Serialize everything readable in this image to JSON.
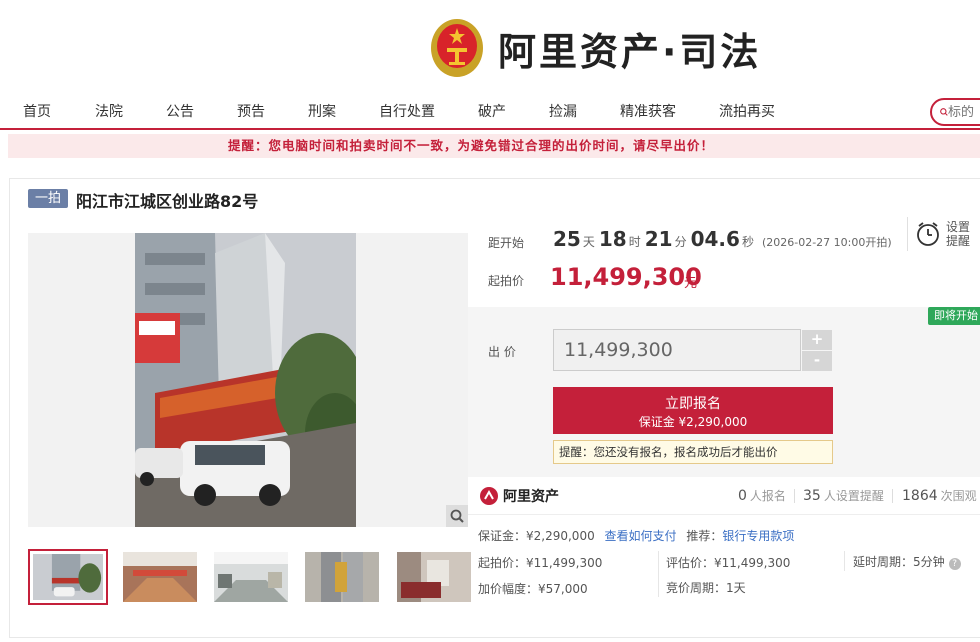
{
  "header": {
    "logo_text": "阿里资产·司法"
  },
  "nav": {
    "items": [
      "首页",
      "法院",
      "公告",
      "预告",
      "刑案",
      "自行处置",
      "破产",
      "捡漏",
      "精准获客",
      "流拍再买"
    ],
    "search_placeholder": "标的"
  },
  "notice": "提醒：您电脑时间和拍卖时间不一致，为避免错过合理的出价时间，请尽早出价！",
  "item": {
    "round_badge": "一拍",
    "title": "阳江市江城区创业路82号"
  },
  "countdown": {
    "label": "距开始",
    "days": "25",
    "days_unit": "天",
    "hours": "18",
    "hours_unit": "时",
    "minutes": "21",
    "minutes_unit": "分",
    "seconds": "04.6",
    "seconds_unit": "秒",
    "start_time": "(2026-02-27 10:00开拍)"
  },
  "starting_price": {
    "label": "起拍价",
    "value": "11,499,300",
    "unit": "元"
  },
  "reminder": {
    "line1": "设置",
    "line2": "提醒"
  },
  "bid": {
    "status_tag": "即将开始",
    "label": "出 价",
    "input_value": "11,499,300",
    "plus": "+",
    "minus": "-",
    "signup_label": "立即报名",
    "deposit_line": "保证金 ¥2,290,000",
    "hint": "提醒：您还没有报名，报名成功后才能出价"
  },
  "stats": {
    "brand": "阿里资产",
    "signups": "0",
    "signups_label": "人报名",
    "reminders": "35",
    "reminders_label": "人设置提醒",
    "views": "1864",
    "views_label": "次围观"
  },
  "details": {
    "deposit": "保证金：¥2,290,000",
    "how_to_pay": "查看如何支付",
    "recommend_label": "推荐：",
    "recommend_link": "银行专用款项",
    "start_price": "起拍价：¥11,499,300",
    "appraisal": "评估价：¥11,499,300",
    "delay": "延时周期：5分钟",
    "increment": "加价幅度：¥57,000",
    "cycle": "竞价周期：1天"
  },
  "colors": {
    "accent": "#c4203a",
    "badge": "#6b7fa6",
    "status_green": "#2fa85a",
    "link": "#3b6fc4"
  }
}
